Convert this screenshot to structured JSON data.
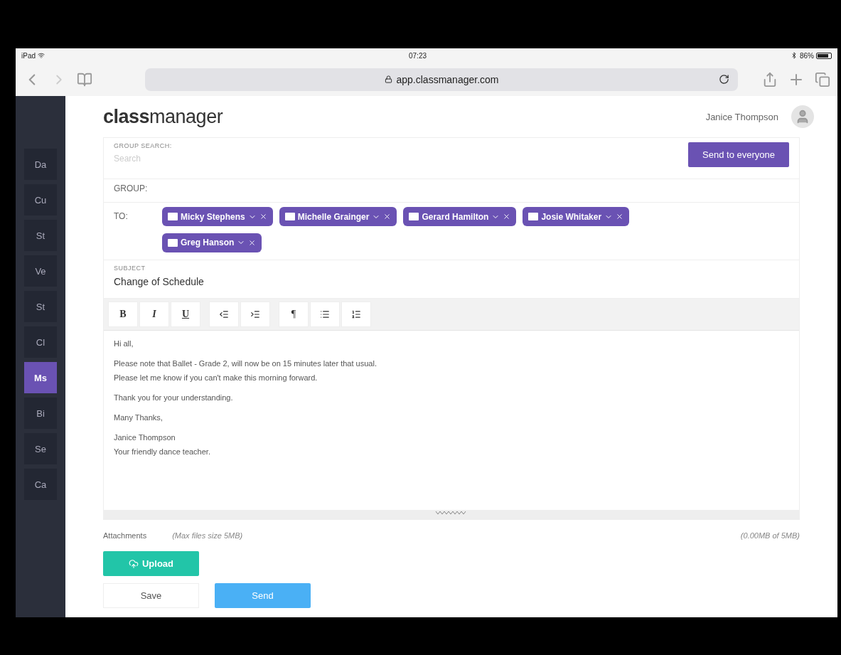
{
  "status_bar": {
    "device": "iPad",
    "time": "07:23",
    "battery": "86%"
  },
  "browser": {
    "url": "app.classmanager.com"
  },
  "header": {
    "logo_bold": "class",
    "logo_light": "manager",
    "user_name": "Janice Thompson"
  },
  "sidebar": {
    "items": [
      {
        "label": "Da",
        "selected": false
      },
      {
        "label": "Cu",
        "selected": false
      },
      {
        "label": "St",
        "selected": false
      },
      {
        "label": "Ve",
        "selected": false
      },
      {
        "label": "St",
        "selected": false
      },
      {
        "label": "Cl",
        "selected": false
      },
      {
        "label": "Ms",
        "selected": true
      },
      {
        "label": "Bi",
        "selected": false
      },
      {
        "label": "Se",
        "selected": false
      },
      {
        "label": "Ca",
        "selected": false
      }
    ]
  },
  "compose": {
    "group_search": {
      "label": "GROUP SEARCH:",
      "placeholder": "Search"
    },
    "send_to_everyone": "Send to everyone",
    "group_label": "GROUP:",
    "to_label": "TO:",
    "recipients": [
      "Micky Stephens",
      "Michelle Grainger",
      "Gerard Hamilton",
      "Josie Whitaker",
      "Greg Hanson"
    ],
    "subject": {
      "label": "SUBJECT",
      "value": "Change of Schedule"
    },
    "toolbar": [
      {
        "kind": "bold",
        "label": "B"
      },
      {
        "kind": "italic",
        "label": "I"
      },
      {
        "kind": "underline",
        "label": "U"
      },
      {
        "kind": "outdent"
      },
      {
        "kind": "indent"
      },
      {
        "kind": "paragraph",
        "label": "¶"
      },
      {
        "kind": "bullets"
      },
      {
        "kind": "numbers"
      }
    ],
    "body": [
      [
        "Hi all,"
      ],
      [
        "Please note that Ballet - Grade 2, will now be on 15 minutes later that usual.",
        "Please let me know if you can't make this morning forward."
      ],
      [
        "Thank you for your understanding."
      ],
      [
        "Many Thanks,"
      ],
      [
        "Janice Thompson",
        "Your friendly dance teacher."
      ]
    ],
    "attachments": {
      "label": "Attachments",
      "limit": "(Max files size 5MB)",
      "usage": "(0.00MB of 5MB)",
      "upload": "Upload"
    },
    "save": "Save",
    "send": "Send"
  }
}
